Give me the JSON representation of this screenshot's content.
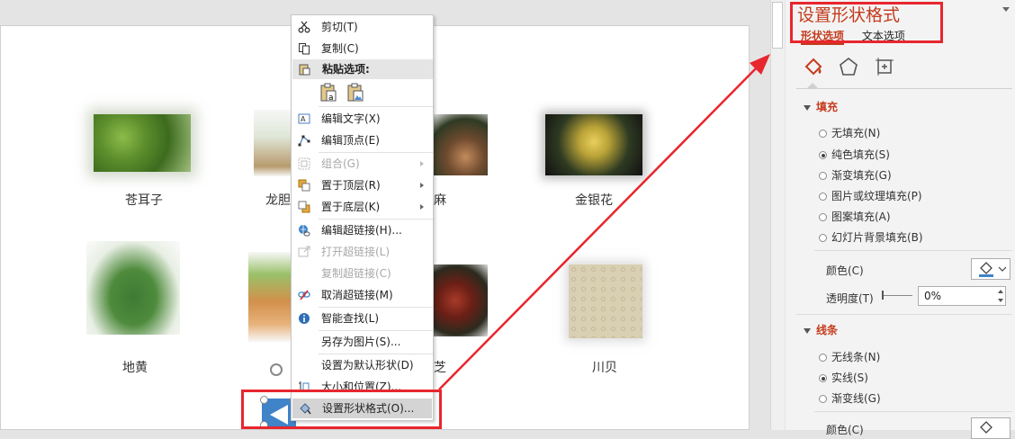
{
  "slide": {
    "herbs": [
      {
        "name": "苍耳子"
      },
      {
        "name": "龙胆"
      },
      {
        "name": "麻"
      },
      {
        "name": "金银花"
      },
      {
        "name": "地黄"
      },
      {
        "name": "芝"
      },
      {
        "name": "川贝"
      }
    ]
  },
  "context_menu": {
    "items": [
      {
        "label": "剪切(T)",
        "icon": "scissors-icon"
      },
      {
        "label": "复制(C)",
        "icon": "copy-icon"
      },
      {
        "label": "粘贴选项:",
        "icon": "paste-icon"
      },
      {
        "label": "编辑文字(X)",
        "icon": "edit-text-icon"
      },
      {
        "label": "编辑顶点(E)",
        "icon": "edit-points-icon"
      },
      {
        "label": "组合(G)",
        "icon": "group-icon",
        "disabled": true
      },
      {
        "label": "置于顶层(R)",
        "icon": "bring-front-icon"
      },
      {
        "label": "置于底层(K)",
        "icon": "send-back-icon"
      },
      {
        "label": "编辑超链接(H)...",
        "icon": "hyperlink-icon"
      },
      {
        "label": "打开超链接(L)",
        "icon": "open-link-icon",
        "disabled": true
      },
      {
        "label": "复制超链接(C)",
        "icon": "",
        "disabled": true
      },
      {
        "label": "取消超链接(M)",
        "icon": "remove-link-icon"
      },
      {
        "label": "智能查找(L)",
        "icon": "smart-lookup-icon"
      },
      {
        "label": "另存为图片(S)...",
        "icon": ""
      },
      {
        "label": "设置为默认形状(D)",
        "icon": ""
      },
      {
        "label": "大小和位置(Z)...",
        "icon": "size-position-icon"
      },
      {
        "label": "设置形状格式(O)...",
        "icon": "format-shape-icon"
      }
    ]
  },
  "format_pane": {
    "title": "设置形状格式",
    "tabs": [
      "形状选项",
      "文本选项"
    ],
    "fill": {
      "header": "填充",
      "options": [
        "无填充(N)",
        "纯色填充(S)",
        "渐变填充(G)",
        "图片或纹理填充(P)",
        "图案填充(A)",
        "幻灯片背景填充(B)"
      ],
      "selected": "纯色填充(S)",
      "color_label": "颜色(C)",
      "transparency_label": "透明度(T)",
      "transparency_value": "0%"
    },
    "line": {
      "header": "线条",
      "options": [
        "无线条(N)",
        "实线(S)",
        "渐变线(G)"
      ],
      "selected": "实线(S)",
      "color_label": "颜色(C)"
    }
  },
  "colors": {
    "accent": "#c43b1d",
    "highlight_box": "#e8262e",
    "arrow": "#e8262e"
  }
}
